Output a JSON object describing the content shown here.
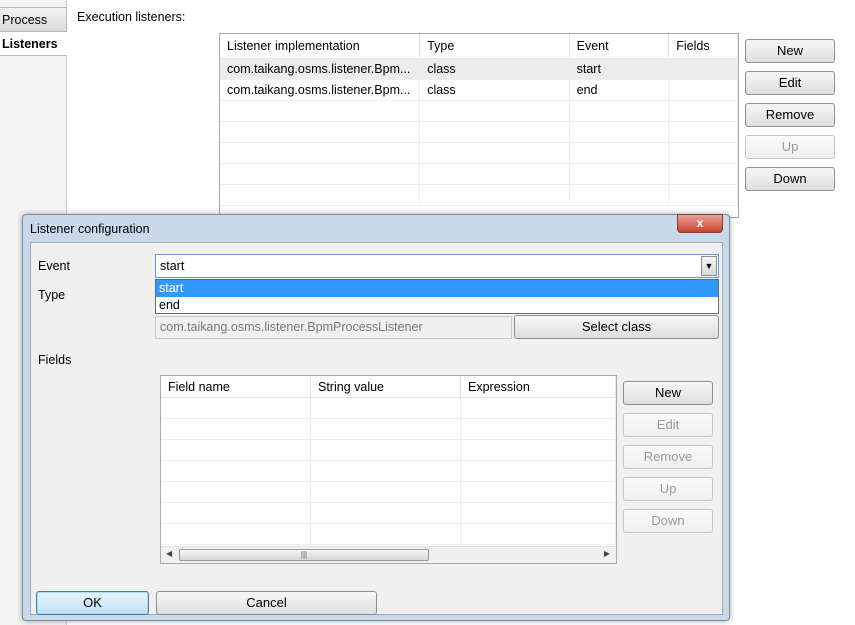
{
  "left_tabs": [
    {
      "label": "Process"
    },
    {
      "label": "Listeners"
    }
  ],
  "execution_label": "Execution listeners:",
  "listeners_table": {
    "columns": [
      "Listener implementation",
      "Type",
      "Event",
      "Fields"
    ],
    "rows": [
      [
        "com.taikang.osms.listener.Bpm...",
        "class",
        "start",
        ""
      ],
      [
        "com.taikang.osms.listener.Bpm...",
        "class",
        "end",
        ""
      ]
    ]
  },
  "listener_buttons": {
    "new": "New",
    "edit": "Edit",
    "remove": "Remove",
    "up": "Up",
    "down": "Down"
  },
  "dialog": {
    "title": "Listener configuration",
    "close_glyph": "x",
    "event_label": "Event",
    "event_value": "start",
    "event_options": [
      "start",
      "end"
    ],
    "type_label": "Type",
    "class_value": "com.taikang.osms.listener.BpmProcessListener",
    "select_class_label": "Select class",
    "fields_label": "Fields",
    "fields_table": {
      "columns": [
        "Field name",
        "String value",
        "Expression"
      ]
    },
    "field_buttons": {
      "new": "New",
      "edit": "Edit",
      "remove": "Remove",
      "up": "Up",
      "down": "Down"
    },
    "ok_label": "OK",
    "cancel_label": "Cancel"
  }
}
